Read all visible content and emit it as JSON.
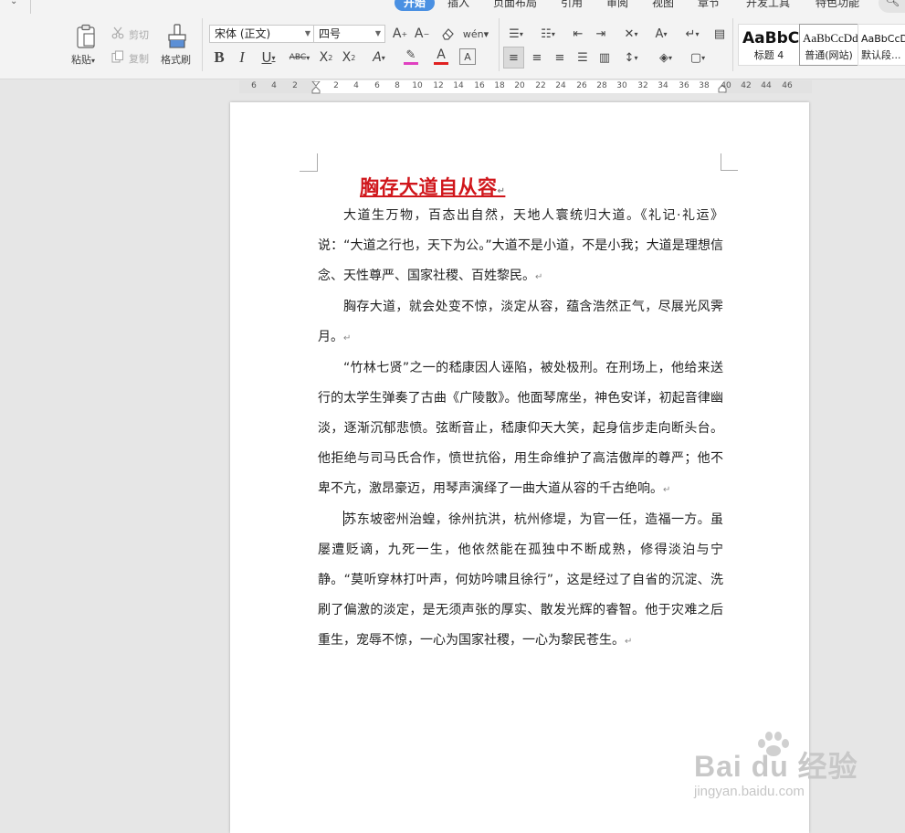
{
  "ribbon": {
    "tabs": [
      {
        "label": "开始",
        "active": true
      },
      {
        "label": "插入",
        "active": false
      },
      {
        "label": "页面布局",
        "active": false
      },
      {
        "label": "引用",
        "active": false
      },
      {
        "label": "审阅",
        "active": false
      },
      {
        "label": "视图",
        "active": false
      },
      {
        "label": "章节",
        "active": false
      },
      {
        "label": "开发工具",
        "active": false
      },
      {
        "label": "特色功能",
        "active": false
      }
    ],
    "clipboard": {
      "paste": "粘贴",
      "cut": "剪切",
      "copy": "复制",
      "format_painter": "格式刷"
    },
    "font": {
      "name": "宋体 (正文)",
      "size": "四号"
    },
    "styles": [
      {
        "sample": "AaBbC",
        "name": "标题 4"
      },
      {
        "sample": "AaBbCcDd",
        "name": "普通(网站)"
      },
      {
        "sample": "AaBbCcD",
        "name": "默认段..."
      }
    ],
    "colors": {
      "accent": "#4a90e2",
      "highlight_bar": "#e040c0",
      "font_color_bar": "#e02020"
    }
  },
  "ruler": {
    "numbers": [
      "6",
      "4",
      "2",
      "2",
      "4",
      "6",
      "8",
      "10",
      "12",
      "14",
      "16",
      "18",
      "20",
      "22",
      "24",
      "26",
      "28",
      "30",
      "32",
      "34",
      "36",
      "38",
      "40",
      "42",
      "44",
      "46"
    ]
  },
  "document": {
    "title": "胸存大道自从容",
    "title_color": "#d0161b",
    "paragraphs": [
      "大道生万物，百态出自然，天地人寰统归大道。《礼记·礼运》说：“大道之行也，天下为公。”大道不是小道，不是小我；大道是理想信念、天性尊严、国家社稷、百姓黎民。",
      "胸存大道，就会处变不惊，淡定从容，蕴含浩然正气，尽展光风霁月。",
      "“竹林七贤”之一的嵇康因人诬陷，被处极刑。在刑场上，他给来送行的太学生弹奏了古曲《广陵散》。他面琴席坐，神色安详，初起音律幽淡，逐渐沉郁悲愤。弦断音止，嵇康仰天大笑，起身信步走向断头台。他拒绝与司马氏合作，愤世抗俗，用生命维护了高洁傲岸的尊严；他不卑不亢，激昂豪迈，用琴声演绎了一曲大道从容的千古绝响。",
      "苏东坡密州治蝗，徐州抗洪，杭州修堤，为官一任，造福一方。虽屡遭贬谪，九死一生，他依然能在孤独中不断成熟，修得淡泊与宁静。“莫听穿林打叶声，何妨吟啸且徐行”，这是经过了自省的沉淀、洗刷了偏激的淡定，是无须声张的厚实、散发光辉的睿智。他于灾难之后重生，宠辱不惊，一心为国家社稷，一心为黎民苍生。"
    ]
  },
  "watermark": {
    "text": "Bai du 经验",
    "url": "jingyan.baidu.com"
  }
}
